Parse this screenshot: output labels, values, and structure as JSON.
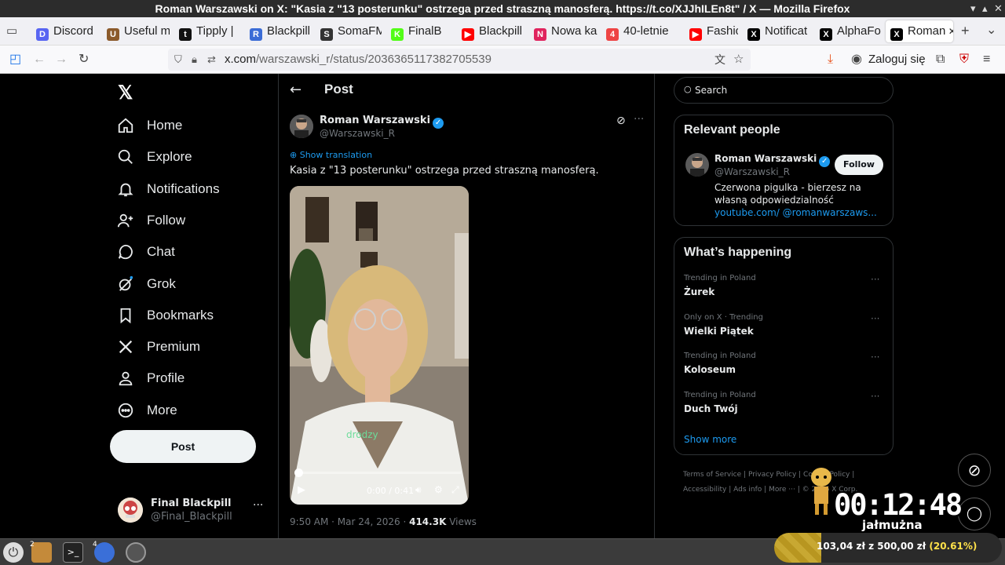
{
  "window": {
    "title": "Roman Warszawski on X: \"Kasia z \"13 posterunku\" ostrzega przed straszną manosferą. https://t.co/XJJhILEn8t\" / X — Mozilla Firefox"
  },
  "tabs": [
    {
      "label": "Discord",
      "color": "#5865f2",
      "glyph": "D"
    },
    {
      "label": "Useful m",
      "color": "#8b5a2b",
      "glyph": "U"
    },
    {
      "label": "Tipply | ",
      "color": "#111111",
      "glyph": "t"
    },
    {
      "label": "Blackpill",
      "color": "#3b6cd6",
      "glyph": "R"
    },
    {
      "label": "SomaFM",
      "color": "#333333",
      "glyph": "S"
    },
    {
      "label": "FinalB",
      "color": "#53fc18",
      "glyph": "K"
    },
    {
      "label": "Blackpill",
      "color": "#ff0000",
      "glyph": "▶"
    },
    {
      "label": "Nowa ka",
      "color": "#e0245e",
      "glyph": "N"
    },
    {
      "label": "40-letnie",
      "color": "#e44",
      "glyph": "4"
    },
    {
      "label": "Fashion",
      "color": "#ff0000",
      "glyph": "▶"
    },
    {
      "label": "Notificat",
      "color": "#000000",
      "glyph": "X"
    },
    {
      "label": "AlphaFo",
      "color": "#000000",
      "glyph": "X"
    },
    {
      "label": "Roman",
      "color": "#000000",
      "glyph": "X"
    }
  ],
  "url": {
    "host": "x.com",
    "path": "/warszawski_r/status/2036365117382705539"
  },
  "browser": {
    "login_label": "Zaloguj się"
  },
  "nav": {
    "items": [
      {
        "label": "Home",
        "icon": "home-icon"
      },
      {
        "label": "Explore",
        "icon": "search-icon"
      },
      {
        "label": "Notifications",
        "icon": "bell-icon"
      },
      {
        "label": "Follow",
        "icon": "person-add-icon"
      },
      {
        "label": "Chat",
        "icon": "chat-icon"
      },
      {
        "label": "Grok",
        "icon": "grok-icon"
      },
      {
        "label": "Bookmarks",
        "icon": "bookmark-icon"
      },
      {
        "label": "Premium",
        "icon": "x-logo-icon"
      },
      {
        "label": "Profile",
        "icon": "person-icon"
      },
      {
        "label": "More",
        "icon": "more-circle-icon"
      }
    ],
    "post_label": "Post",
    "account": {
      "name": "Final Blackpill",
      "handle": "@Final_Blackpill"
    }
  },
  "post": {
    "header_title": "Post",
    "author": "Roman Warszawski",
    "handle": "@Warszawski_R",
    "show_translation": "Show translation",
    "text": "Kasia z \"13 posterunku\" ostrzega przed straszną manosferą.",
    "video": {
      "caption": "drodzy",
      "time": "0:00 / 0:41",
      "progress": 0.0
    },
    "timestamp": "9:50 AM · Mar 24, 2026 · ",
    "views_count": "414.3K",
    "views_label": " Views"
  },
  "right": {
    "search_placeholder": "Search",
    "relevant_title": "Relevant people",
    "person": {
      "name": "Roman Warszawski",
      "handle": "@Warszawski_R",
      "follow_label": "Follow",
      "bio": "Czerwona pigulka - bierzesz na własną odpowiedzialność ",
      "link": "youtube.com/ @romanwarszaws..."
    },
    "happening_title": "What’s happening",
    "trends": [
      {
        "context": "Trending in Poland",
        "name": "Żurek"
      },
      {
        "context": "Only on X · Trending",
        "name": "Wielki Piątek"
      },
      {
        "context": "Trending in Poland",
        "name": "Koloseum"
      },
      {
        "context": "Trending in Poland",
        "name": "Duch Twój"
      }
    ],
    "show_more": "Show more",
    "footer": [
      "Terms of Service",
      "Privacy Policy",
      "Cookie Policy",
      "Accessibility",
      "Ads info",
      "More ···",
      "© 2026 X Corp."
    ]
  },
  "overlay": {
    "timer": "00:12:48",
    "subtitle": "jałmużna",
    "donation": "103,04 zł  z  500,00 zł",
    "donation_pct": "(20.61%)",
    "progress": 0.2061
  },
  "taskbar": {
    "badge1": "2",
    "badge2": "4"
  }
}
